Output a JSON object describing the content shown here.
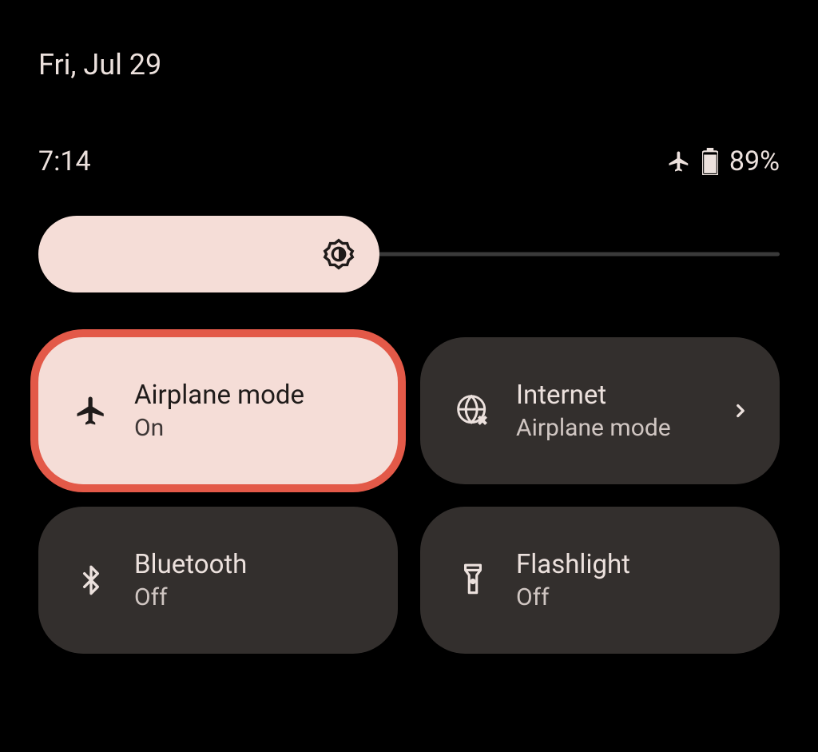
{
  "date": "Fri, Jul 29",
  "status": {
    "time": "7:14",
    "battery_percent": "89%"
  },
  "brightness": {
    "percent": 46
  },
  "tiles": [
    {
      "icon": "airplane",
      "title": "Airplane mode",
      "subtitle": "On",
      "state": "on",
      "highlighted": true
    },
    {
      "icon": "internet",
      "title": "Internet",
      "subtitle": "Airplane mode",
      "state": "off",
      "chevron": true
    },
    {
      "icon": "bluetooth",
      "title": "Bluetooth",
      "subtitle": "Off",
      "state": "off"
    },
    {
      "icon": "flashlight",
      "title": "Flashlight",
      "subtitle": "Off",
      "state": "off"
    }
  ],
  "colors": {
    "accent": "#f5ddd7",
    "tile_off_bg": "#332f2d",
    "highlight": "#e35948"
  }
}
